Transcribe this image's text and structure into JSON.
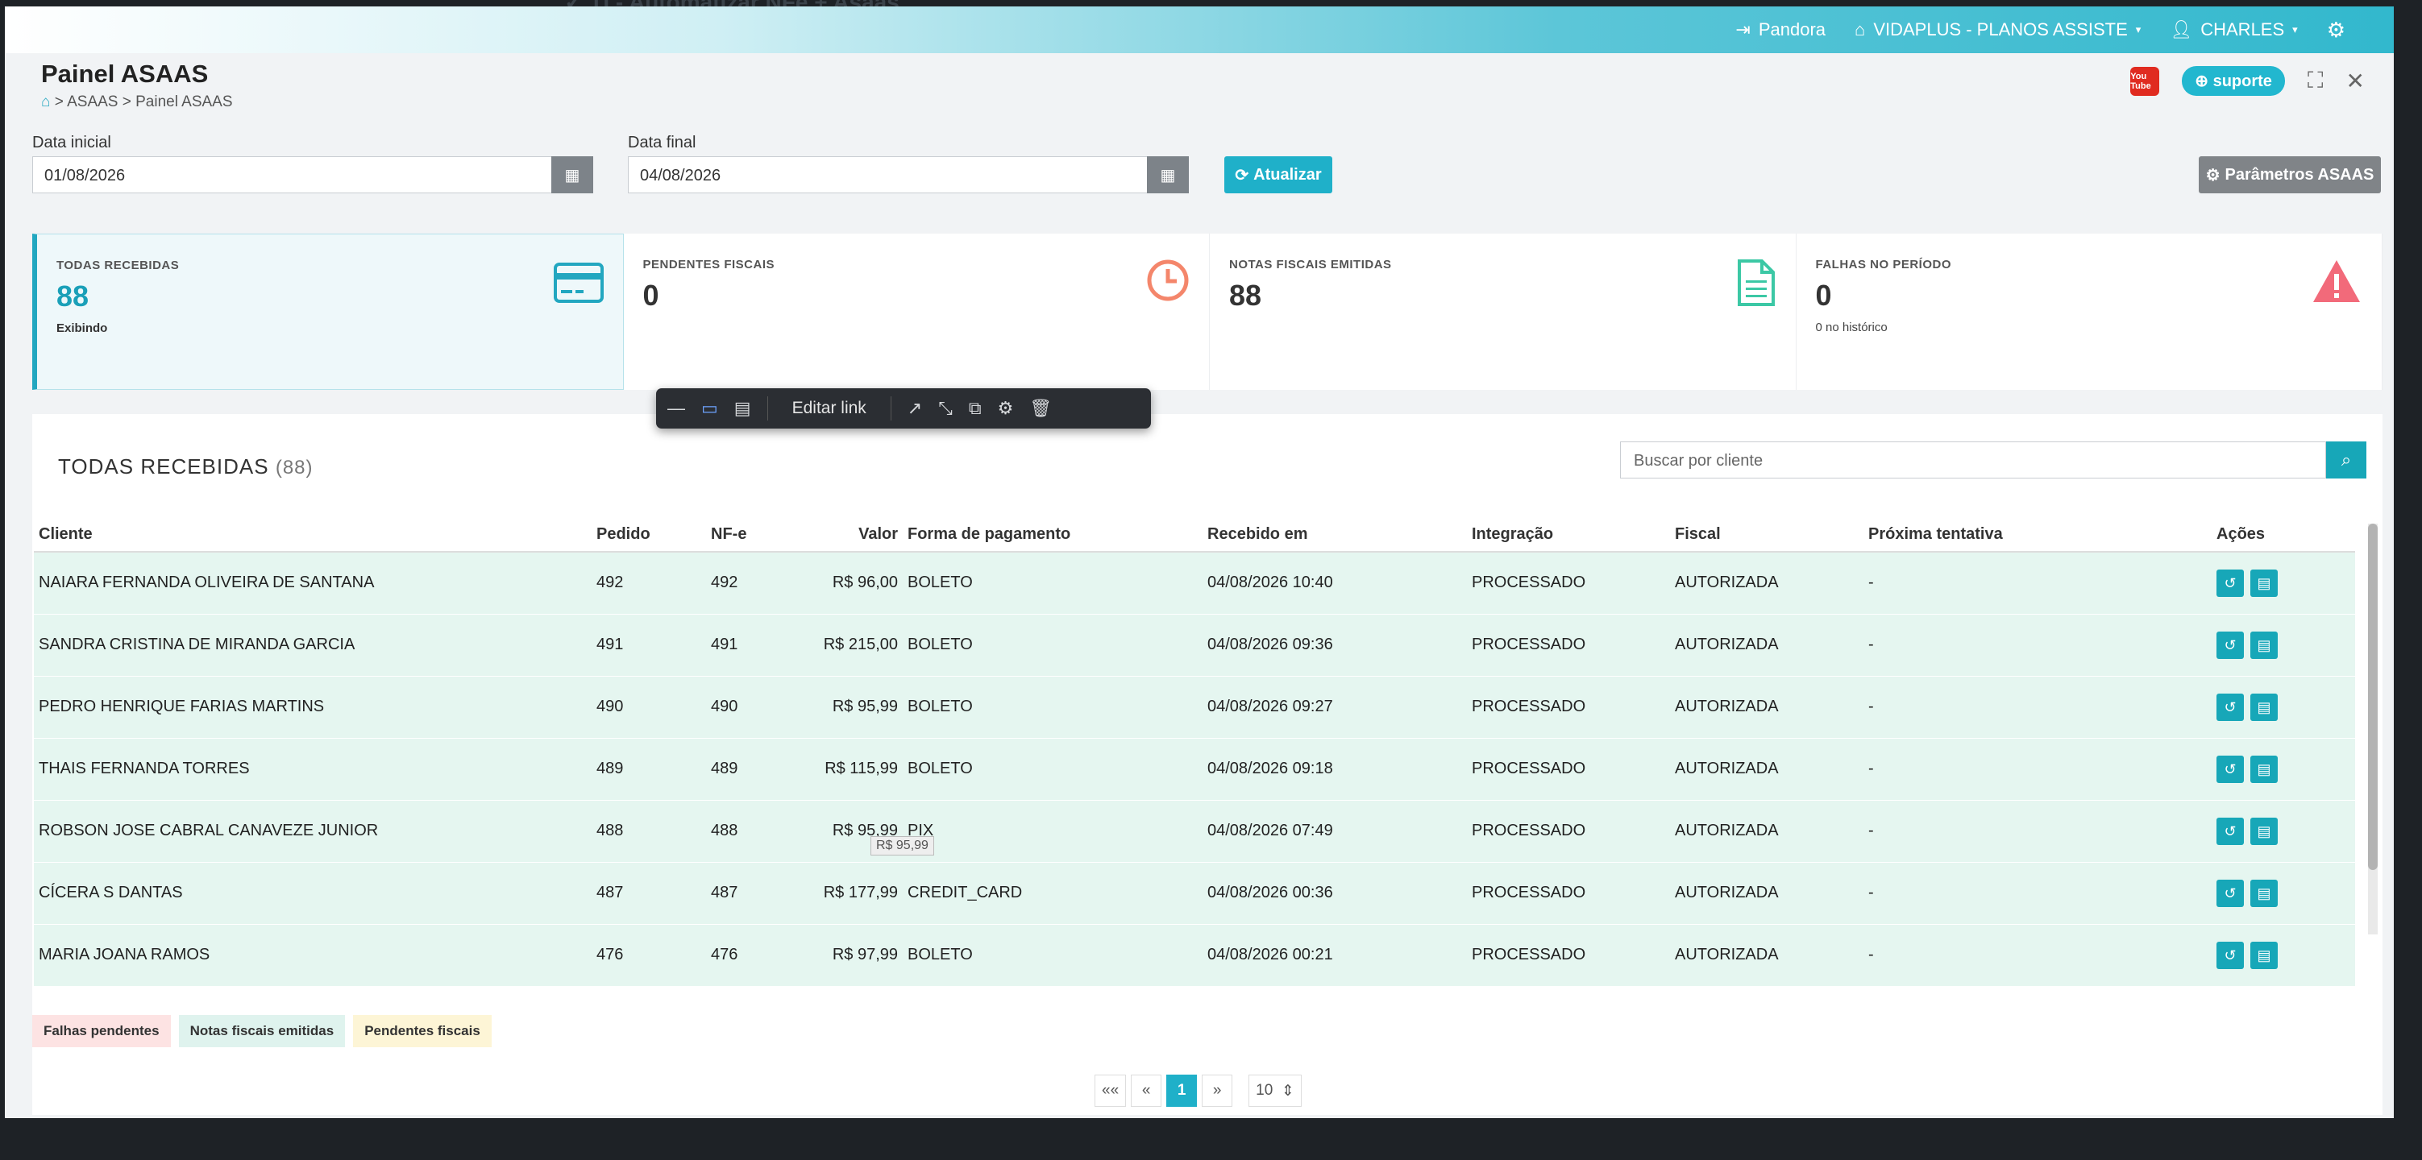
{
  "topbar": {
    "user_link": "Pandora",
    "company": "VIDAPLUS - PLANOS ASSISTE",
    "user": "CHARLES"
  },
  "header": {
    "title": "Painel ASAAS",
    "breadcrumb": "> ASAAS > Painel ASAAS",
    "support_label": "suporte",
    "youtube_label": "You Tube"
  },
  "filters": {
    "start_label": "Data inicial",
    "start_value": "01/08/2026",
    "end_label": "Data final",
    "end_value": "04/08/2026",
    "refresh_label": "Atualizar",
    "params_label": "Parâmetros ASAAS"
  },
  "cards": [
    {
      "label": "TODAS RECEBIDAS",
      "value": "88",
      "sub": "Exibindo"
    },
    {
      "label": "PENDENTES FISCAIS",
      "value": "0",
      "sub": ""
    },
    {
      "label": "NOTAS FISCAIS EMITIDAS",
      "value": "88",
      "sub": ""
    },
    {
      "label": "FALHAS NO PERÍODO",
      "value": "0",
      "sub": "0 no histórico"
    }
  ],
  "toolbar": {
    "edit_link": "Editar link"
  },
  "panel": {
    "title": "TODAS RECEBIDAS",
    "count": "(88)",
    "search_placeholder": "Buscar por cliente"
  },
  "table": {
    "headers": [
      "Cliente",
      "Pedido",
      "NF-e",
      "Valor",
      "Forma de pagamento",
      "Recebido em",
      "Integração",
      "Fiscal",
      "Próxima tentativa",
      "Ações"
    ],
    "rows": [
      [
        "NAIARA FERNANDA OLIVEIRA DE SANTANA",
        "492",
        "492",
        "R$ 96,00",
        "BOLETO",
        "04/08/2026 10:40",
        "PROCESSADO",
        "AUTORIZADA",
        "-"
      ],
      [
        "SANDRA CRISTINA DE MIRANDA GARCIA",
        "491",
        "491",
        "R$ 215,00",
        "BOLETO",
        "04/08/2026 09:36",
        "PROCESSADO",
        "AUTORIZADA",
        "-"
      ],
      [
        "PEDRO HENRIQUE FARIAS MARTINS",
        "490",
        "490",
        "R$ 95,99",
        "BOLETO",
        "04/08/2026 09:27",
        "PROCESSADO",
        "AUTORIZADA",
        "-"
      ],
      [
        "THAIS FERNANDA TORRES",
        "489",
        "489",
        "R$ 115,99",
        "BOLETO",
        "04/08/2026 09:18",
        "PROCESSADO",
        "AUTORIZADA",
        "-"
      ],
      [
        "ROBSON JOSE CABRAL CANAVEZE JUNIOR",
        "488",
        "488",
        "R$ 95,99",
        "PIX",
        "04/08/2026 07:49",
        "PROCESSADO",
        "AUTORIZADA",
        "-"
      ],
      [
        "CÍCERA S DANTAS",
        "487",
        "487",
        "R$ 177,99",
        "CREDIT_CARD",
        "04/08/2026 00:36",
        "PROCESSADO",
        "AUTORIZADA",
        "-"
      ],
      [
        "MARIA JOANA RAMOS",
        "476",
        "476",
        "R$ 97,99",
        "BOLETO",
        "04/08/2026 00:21",
        "PROCESSADO",
        "AUTORIZADA",
        "-"
      ]
    ],
    "tooltip": "R$ 95,99"
  },
  "legend": [
    "Falhas pendentes",
    "Notas fiscais emitidas",
    "Pendentes fiscais"
  ],
  "pagination": {
    "first": "««",
    "prev": "«",
    "current": "1",
    "next": "»",
    "page_size": "10"
  },
  "colors": {
    "accent": "#1fb0c9",
    "row_bg": "#e5f6f0",
    "warning": "#f4866b",
    "danger": "#f26a7a",
    "success": "#3cc8a5"
  }
}
